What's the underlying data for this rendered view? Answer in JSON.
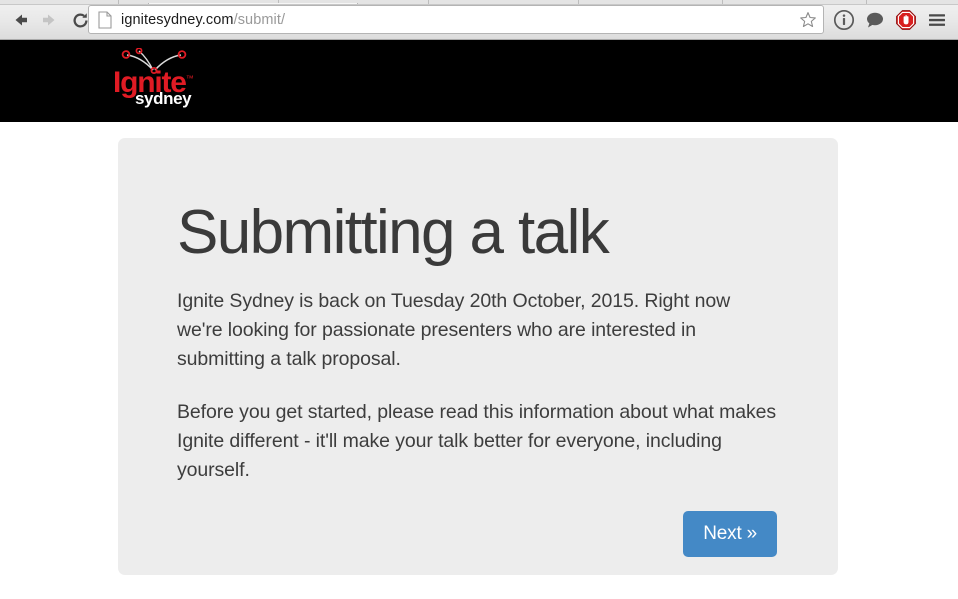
{
  "browser": {
    "back_icon": "back-arrow-icon",
    "forward_icon": "forward-arrow-icon",
    "reload_icon": "reload-icon",
    "page_icon": "page-document-icon",
    "url_domain": "ignitesydney.com",
    "url_path": "/submit/",
    "star_icon": "bookmark-star-icon",
    "extensions": [
      {
        "name": "info-circle-icon",
        "label": "i"
      },
      {
        "name": "chat-bubble-icon",
        "label": ""
      },
      {
        "name": "adblock-stop-hand-icon",
        "label": ""
      },
      {
        "name": "hamburger-menu-icon",
        "label": ""
      }
    ]
  },
  "site_header": {
    "logo_name": "Ignite",
    "logo_tm": "™",
    "logo_sub": "sydney",
    "logo_color": "#e01b24",
    "background": "#000000"
  },
  "main": {
    "card_background": "#ededed",
    "title": "Submitting a talk",
    "paragraphs": [
      "Ignite Sydney is back on Tuesday 20th October, 2015. Right now we're looking for passionate presenters who are interested in submitting a talk proposal.",
      "Before you get started, please read this information about what makes Ignite different - it'll make your talk better for everyone, including yourself."
    ],
    "next_button_label": "Next »",
    "next_button_color": "#4489c6"
  }
}
